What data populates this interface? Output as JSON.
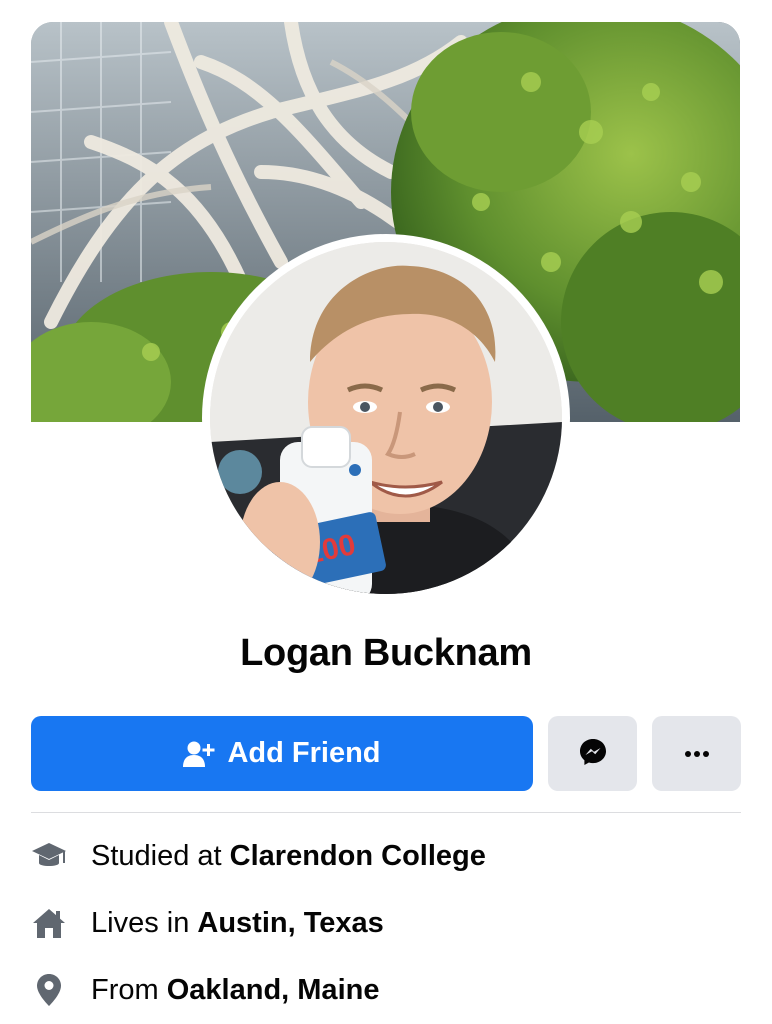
{
  "profile": {
    "name": "Logan Bucknam",
    "cover_alt": "cover-photo",
    "avatar_alt": "profile-picture"
  },
  "actions": {
    "add_friend_label": "Add Friend",
    "add_friend_icon": "add-friend-icon",
    "messenger_icon": "messenger-icon",
    "more_icon": "more-dots-icon"
  },
  "intro": {
    "education": {
      "prefix": "Studied at",
      "value": "Clarendon College",
      "icon": "graduation-cap-icon"
    },
    "residence": {
      "prefix": "Lives in",
      "value": "Austin, Texas",
      "icon": "home-icon"
    },
    "hometown": {
      "prefix": "From",
      "value": "Oakland, Maine",
      "icon": "location-pin-icon"
    }
  },
  "colors": {
    "primary": "#1877f2",
    "secondary_button": "#e4e6eb",
    "icon_gray": "#606770"
  }
}
